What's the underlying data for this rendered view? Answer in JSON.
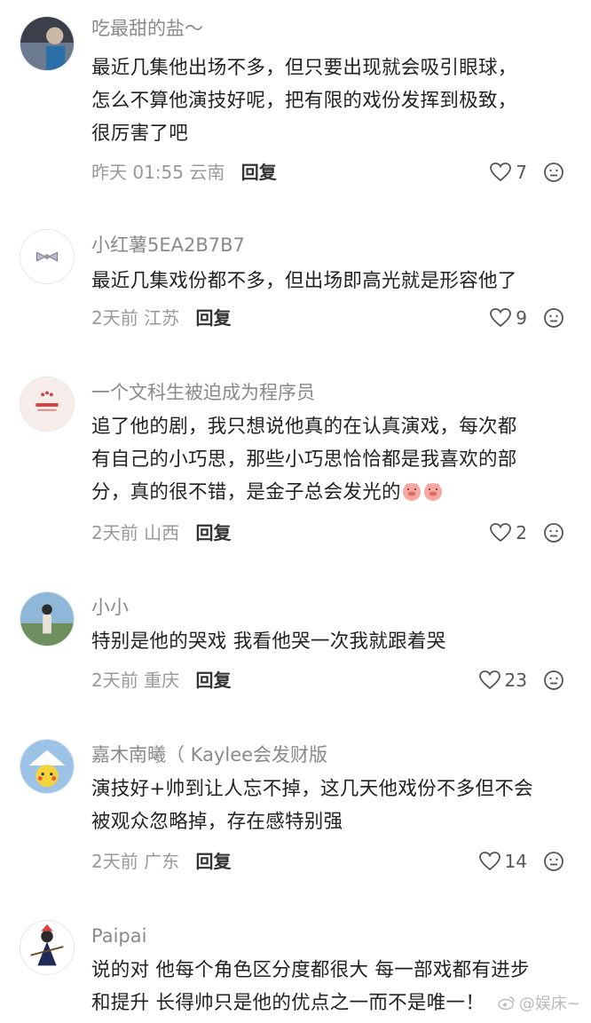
{
  "comments": [
    {
      "user": "吃最甜的盐～",
      "lines": [
        "最近几集他出场不多，但只要出现就会吸引眼球，",
        "怎么不算他演技好呢，把有限的戏份发挥到极致，",
        "很厉害了吧"
      ],
      "time_location": "昨天 01:55 云南",
      "reply": "回复",
      "likes": "7"
    },
    {
      "user": "小红薯5EA2B7B7",
      "lines": [
        "最近几集戏份都不多，但出场即高光就是形容他了"
      ],
      "time_location": "2天前 江苏",
      "reply": "回复",
      "likes": "9"
    },
    {
      "user": "一个文科生被迫成为程序员",
      "lines": [
        "追了他的剧，我只想说他真的在认真演戏，每次都",
        "有自己的小巧思，那些小巧思恰恰都是我喜欢的部",
        "分，真的很不错，是金子总会发光的"
      ],
      "time_location": "2天前 山西",
      "reply": "回复",
      "likes": "2"
    },
    {
      "user": "小小",
      "lines": [
        "特别是他的哭戏 我看他哭一次我就跟着哭"
      ],
      "time_location": "2天前 重庆",
      "reply": "回复",
      "likes": "23"
    },
    {
      "user": "嘉木南曦（ Kaylee会发财版",
      "lines": [
        "演技好+帅到让人忘不掉，这几天他戏份不多但不会",
        "被观众忽略掉，存在感特别强"
      ],
      "time_location": "2天前 广东",
      "reply": "回复",
      "likes": "14"
    },
    {
      "user": "Paipai",
      "lines": [
        "说的对 他每个角色区分度都很大 每一部戏都有进步",
        "和提升 长得帅只是他的优点之一而不是唯一！"
      ],
      "time_location": "",
      "reply": "",
      "likes": ""
    }
  ],
  "watermark": "@娱床~",
  "icons": {
    "like": "heart-outline-icon",
    "react": "face-icon",
    "emoji": "pig-face-emoji"
  }
}
